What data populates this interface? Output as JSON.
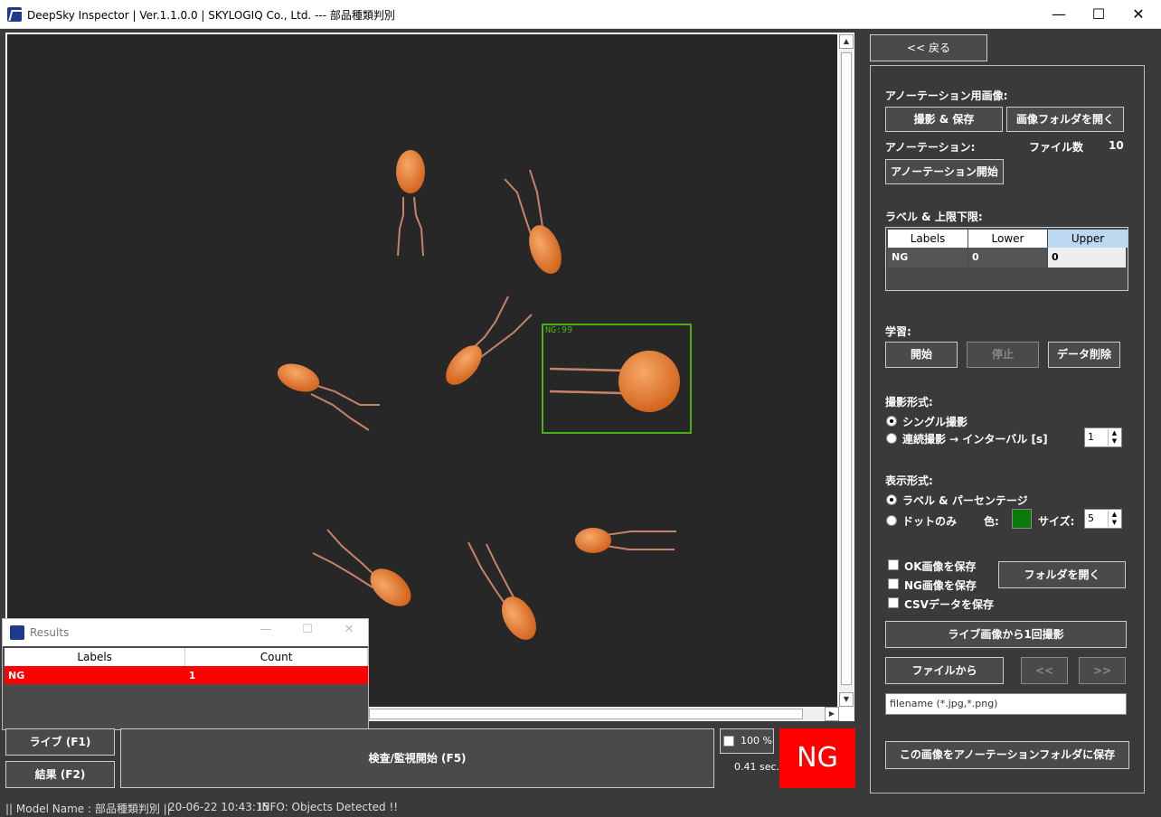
{
  "window": {
    "title": "DeepSky Inspector | Ver.1.1.0.0 | SKYLOGIQ Co., Ltd. --- 部品種類判別",
    "min": "—",
    "max": "☐",
    "close": "✕"
  },
  "viewer": {
    "detection_label": "NG:99"
  },
  "results_window": {
    "title": "Results",
    "columns": [
      "Labels",
      "Count"
    ],
    "rows": [
      {
        "label": "NG",
        "count": "1"
      }
    ]
  },
  "bottom": {
    "live_button": "ライブ (F1)",
    "result_button": "結果 (F2)",
    "inspect_button": "検査/監視開始 (F5)",
    "zoom_label": "100 %",
    "elapsed": "0.41 sec.",
    "verdict": "NG",
    "verdict_color": "#ff0000"
  },
  "panel": {
    "back_button": "<< 戻る",
    "annotation_images_heading": "アノーテーション用画像:",
    "capture_save_button": "撮影 & 保存",
    "open_image_folder_button": "画像フォルダを開く",
    "annotation_heading": "アノーテーション:",
    "file_count_label": "ファイル数",
    "file_count_value": "10",
    "start_annotation_button": "アノーテーション開始",
    "label_limits_heading": "ラベル & 上限下限:",
    "grid_columns": [
      "Labels",
      "Lower",
      "Upper"
    ],
    "grid_row": {
      "label": "NG",
      "lower": "0",
      "upper": "0"
    },
    "training_heading": "学習:",
    "train_start_button": "開始",
    "train_stop_button": "停止",
    "delete_data_button": "データ削除",
    "capture_mode_heading": "撮影形式:",
    "single_capture": "シングル撮影",
    "continuous_capture": "連続撮影 → インターバル [s]",
    "interval_value": "1",
    "display_mode_heading": "表示形式:",
    "label_percentage": "ラベル & パーセンテージ",
    "dot_only": "ドットのみ",
    "color_label": "色:",
    "dot_color": "#0a7a0a",
    "size_label": "サイズ:",
    "size_value": "5",
    "save_ok": "OK画像を保存",
    "save_ng": "NG画像を保存",
    "save_csv": "CSVデータを保存",
    "open_folder_button": "フォルダを開く",
    "capture_from_live_button": "ライブ画像から1回撮影",
    "from_file_button": "ファイルから",
    "prev_button": "<<",
    "next_button": ">>",
    "filename_placeholder": "filename (*.jpg,*.png)",
    "save_to_annotation_button": "この画像をアノーテーションフォルダに保存"
  },
  "status": {
    "model": "|| Model Name : 部品種類判別 ||",
    "timestamp": "20-06-22 10:43:15",
    "info": "INFO:   Objects Detected !!"
  }
}
